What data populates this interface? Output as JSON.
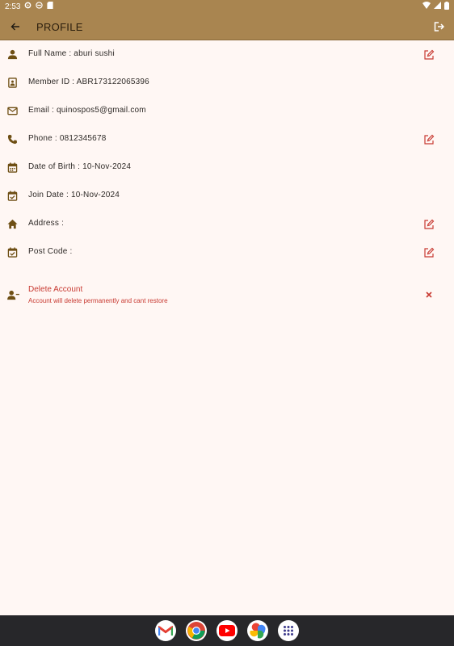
{
  "status": {
    "time": "2:53"
  },
  "header": {
    "title": "PROFILE"
  },
  "profile_rows": [
    {
      "label": "Full Name : aburi sushi",
      "icon": "person-icon",
      "editable": true
    },
    {
      "label": "Member ID : ABR173122065396",
      "icon": "id-card-icon",
      "editable": false
    },
    {
      "label": "Email : quinospos5@gmail.com",
      "icon": "mail-icon",
      "editable": false
    },
    {
      "label": "Phone : 0812345678",
      "icon": "phone-icon",
      "editable": true
    },
    {
      "label": "Date of Birth : 10-Nov-2024",
      "icon": "calendar-icon",
      "editable": false
    },
    {
      "label": "Join Date : 10-Nov-2024",
      "icon": "event-check-icon",
      "editable": false
    },
    {
      "label": "Address :",
      "icon": "home-icon",
      "editable": true
    },
    {
      "label": "Post Code :",
      "icon": "event-check-icon",
      "editable": true
    }
  ],
  "delete_account": {
    "title": "Delete Account",
    "subtitle": "Account will delete permanently and cant restore"
  },
  "colors": {
    "appbar": "#a98550",
    "background": "#fff7f4",
    "icon_brown": "#6e4f14",
    "danger": "#c83a32"
  },
  "dock": [
    "gmail-icon",
    "chrome-icon",
    "youtube-icon",
    "photos-icon",
    "app-drawer-icon"
  ]
}
